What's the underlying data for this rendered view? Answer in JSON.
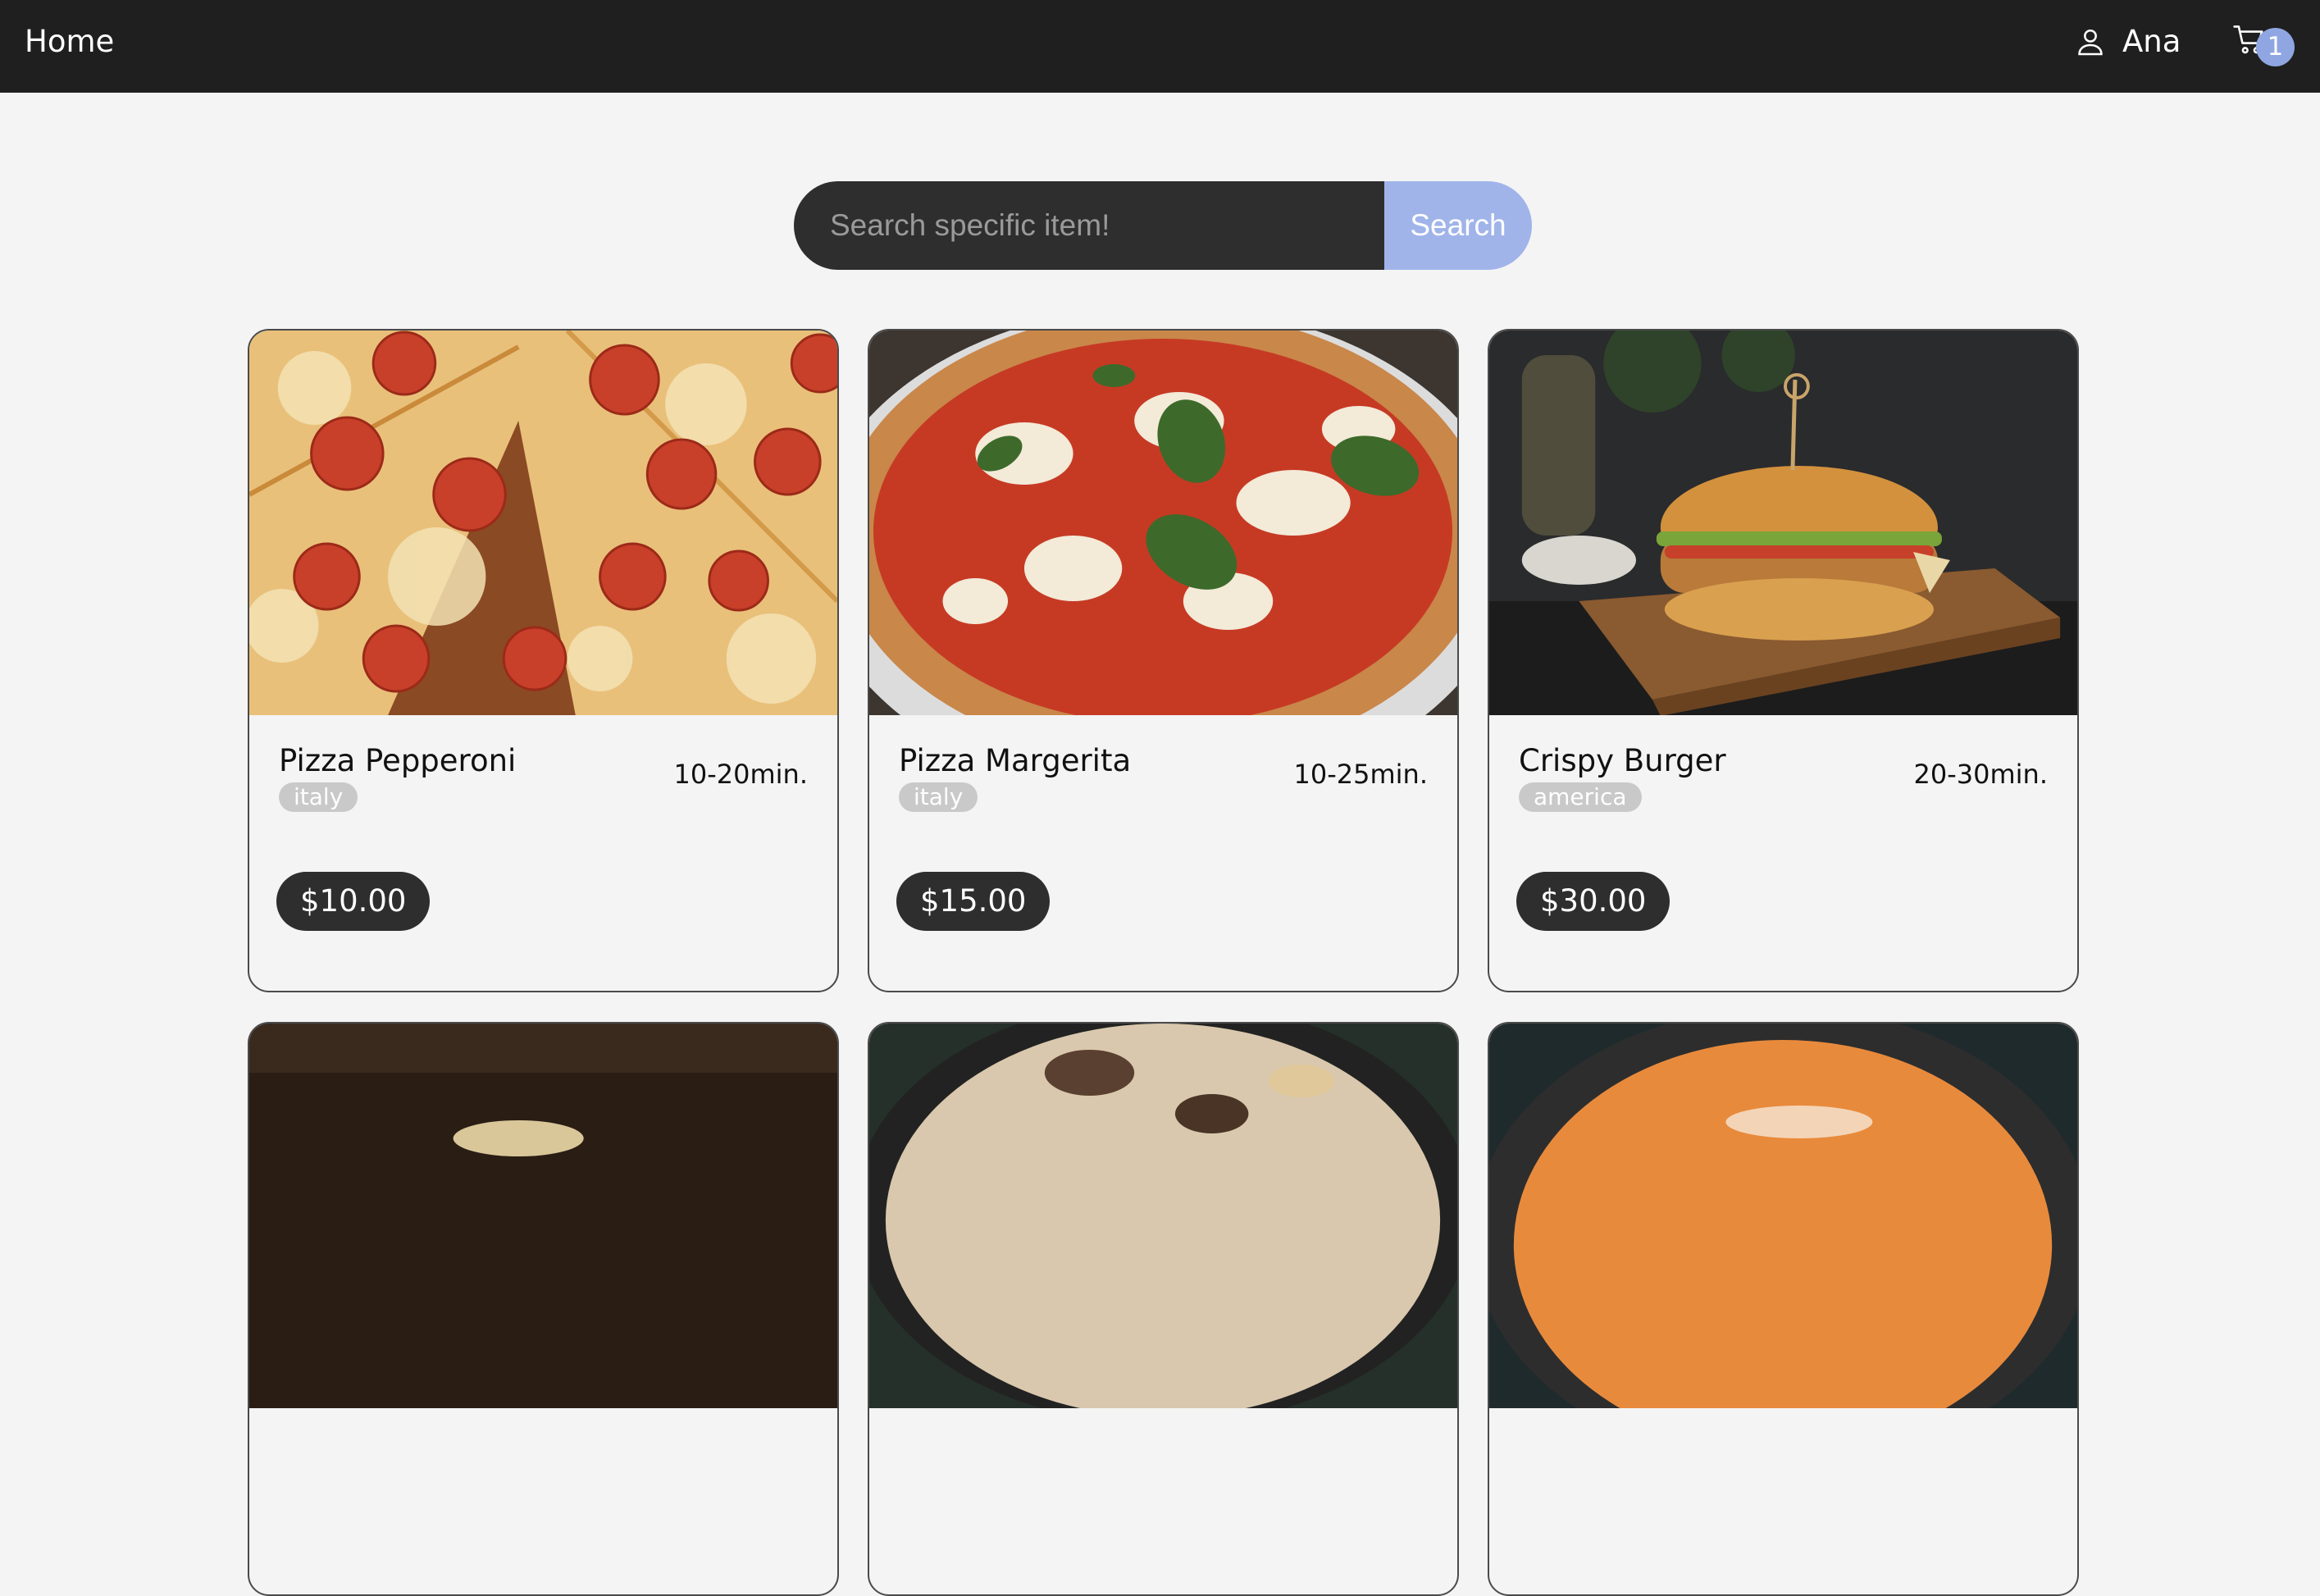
{
  "nav": {
    "home_label": "Home",
    "user_icon": "user-icon",
    "user_name": "Ana",
    "cart_icon": "cart-icon",
    "cart_count": "1"
  },
  "search": {
    "placeholder": "Search specific item!",
    "button_label": "Search"
  },
  "colors": {
    "navbar": "#1f1f1f",
    "page_background": "#f4f4f4",
    "accent": "#a0b4ea",
    "badge": "#8fa6e2",
    "price_pill": "#2e2e2e"
  },
  "cards": [
    {
      "name": "Pizza Pepperoni",
      "tag": "italy",
      "time": "10-20min.",
      "price": "$10.00",
      "image": "pepperoni-pizza-photo"
    },
    {
      "name": "Pizza Margerita",
      "tag": "italy",
      "time": "10-25min.",
      "price": "$15.00",
      "image": "margherita-pizza-photo"
    },
    {
      "name": "Crispy Burger",
      "tag": "america",
      "time": "20-30min.",
      "price": "$30.00",
      "image": "crispy-burger-photo"
    }
  ],
  "partial_cards": [
    {
      "image": "partial-food-photo-dark"
    },
    {
      "image": "partial-mushroom-soup-photo"
    },
    {
      "image": "partial-tomato-soup-photo"
    }
  ]
}
